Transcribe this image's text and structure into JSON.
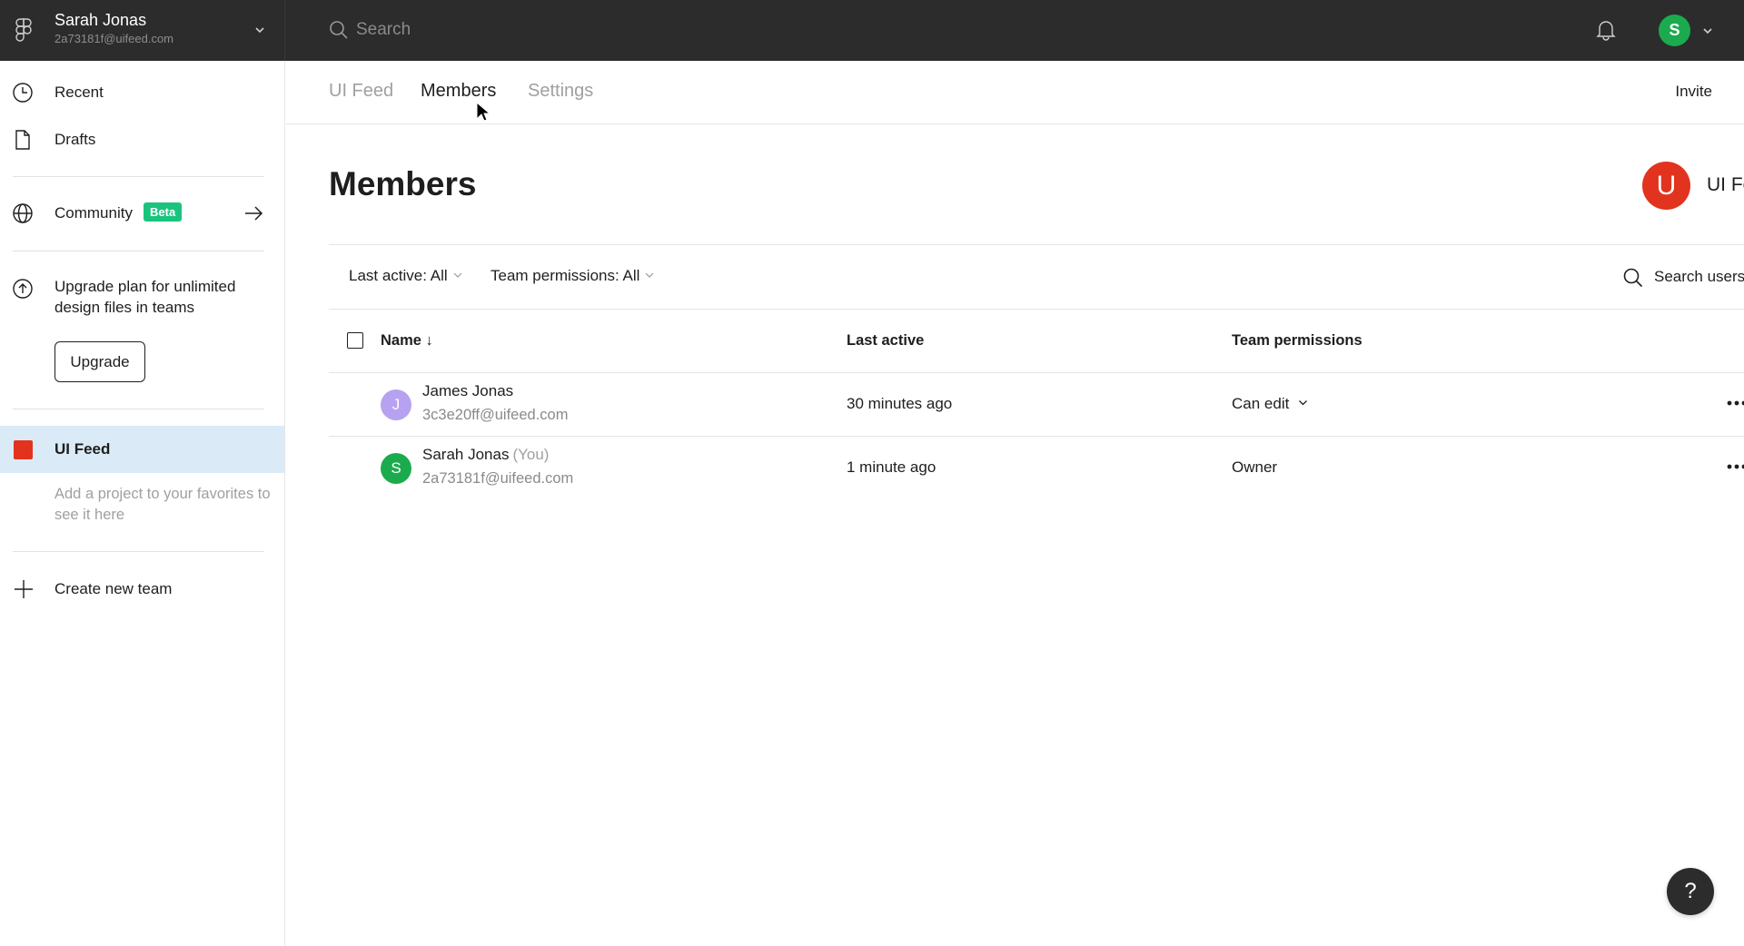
{
  "topbar": {
    "user_name": "Sarah Jonas",
    "user_email": "2a73181f@uifeed.com",
    "search_placeholder": "Search",
    "avatar_initial": "S",
    "avatar_color": "#1bab4e"
  },
  "sidebar": {
    "recent": "Recent",
    "drafts": "Drafts",
    "community": "Community",
    "community_badge": "Beta",
    "upgrade_text": "Upgrade plan for unlimited design files in teams",
    "upgrade_button": "Upgrade",
    "team": {
      "name": "UI Feed",
      "color": "#e2331f"
    },
    "favorites_hint": "Add a project to your favorites to see it here",
    "create_team": "Create new team"
  },
  "tabs": [
    {
      "label": "UI Feed",
      "active": false
    },
    {
      "label": "Members",
      "active": true
    },
    {
      "label": "Settings",
      "active": false
    }
  ],
  "invite_label": "Invite",
  "page": {
    "title": "Members",
    "team_avatar_initial": "U",
    "team_name_truncated": "UI Feed"
  },
  "filters": {
    "last_active": "Last active: All",
    "team_permissions": "Team permissions: All",
    "search_placeholder": "Search users"
  },
  "table": {
    "columns": {
      "name": "Name",
      "name_sort": "↓",
      "last_active": "Last active",
      "permissions": "Team permissions"
    },
    "rows": [
      {
        "initial": "J",
        "avatar_color": "#b6a2f0",
        "name": "James Jonas",
        "suffix": "",
        "email": "3c3e20ff@uifeed.com",
        "last_active": "30 minutes ago",
        "permission": "Can edit",
        "permission_editable": true
      },
      {
        "initial": "S",
        "avatar_color": "#1bab4e",
        "name": "Sarah Jonas",
        "suffix": "(You)",
        "email": "2a73181f@uifeed.com",
        "last_active": "1 minute ago",
        "permission": "Owner",
        "permission_editable": false
      }
    ]
  },
  "help_label": "?"
}
